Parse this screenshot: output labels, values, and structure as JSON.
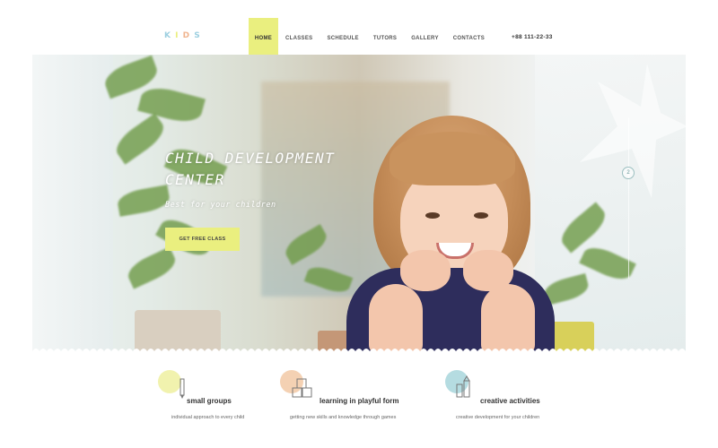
{
  "header": {
    "logo": [
      "K",
      "I",
      "D",
      "S"
    ],
    "logo_colors": [
      "#9ccfe0",
      "#eaef7f",
      "#f0b48e",
      "#9ccfe0"
    ],
    "nav": [
      {
        "label": "HOME",
        "active": true
      },
      {
        "label": "CLASSES",
        "active": false
      },
      {
        "label": "SCHEDULE",
        "active": false
      },
      {
        "label": "TUTORS",
        "active": false
      },
      {
        "label": "GALLERY",
        "active": false
      },
      {
        "label": "CONTACTS",
        "active": false
      }
    ],
    "phone": "+88 111-22-33"
  },
  "hero": {
    "title_line1": "CHILD DEVELOPMENT",
    "title_line2": "CENTER",
    "subtitle": "Best for your children",
    "cta": "GET FREE CLASS",
    "slider_indicator": "2"
  },
  "features": [
    {
      "title": "small groups",
      "description": "individual approach to every child",
      "bubble_color": "#eef0a0",
      "icon": "pencil-icon"
    },
    {
      "title": "learning in playful form",
      "description": "getting new skills and knowledge through games",
      "bubble_color": "#f2c9a6",
      "icon": "blocks-icon"
    },
    {
      "title": "creative activities",
      "description": "creative development for your children",
      "bubble_color": "#a8d6dc",
      "icon": "paints-icon"
    }
  ],
  "colors": {
    "accent_yellow": "#eaef7f",
    "accent_blue": "#9ccfe0",
    "accent_peach": "#f0b48e"
  }
}
